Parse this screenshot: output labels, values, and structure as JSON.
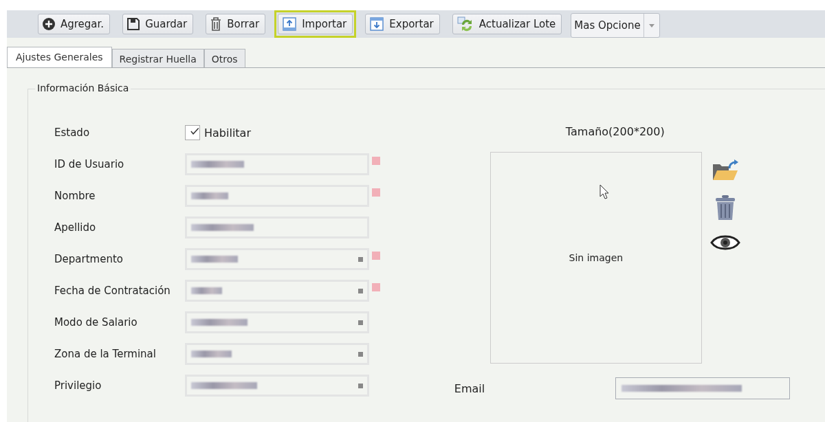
{
  "toolbar": [
    {
      "label": "Agregar.",
      "highlighted": false
    },
    {
      "label": "Guardar",
      "highlighted": false
    },
    {
      "label": "Borrar",
      "highlighted": false
    },
    {
      "label": "Importar",
      "highlighted": true
    },
    {
      "label": "Exportar",
      "highlighted": false
    },
    {
      "label": "Actualizar Lote",
      "highlighted": false
    }
  ],
  "more_options": {
    "value": "Mas Opcione"
  },
  "tabs": [
    {
      "label": "Ajustes Generales",
      "selected": true
    },
    {
      "label": "Registrar Huella",
      "selected": false
    },
    {
      "label": "Otros",
      "selected": false
    }
  ],
  "section": {
    "title": "Información Básica"
  },
  "fields": [
    {
      "label": "Estado",
      "kind": "checkbox",
      "option": "Habilitar",
      "checked": true
    },
    {
      "label": "ID de Usuario",
      "kind": "text",
      "required": true
    },
    {
      "label": "Nombre",
      "kind": "text",
      "required": true
    },
    {
      "label": "Apellido",
      "kind": "text",
      "required": false
    },
    {
      "label": "Departmento",
      "kind": "select",
      "required": true
    },
    {
      "label": "Fecha de Contratación",
      "kind": "select",
      "required": true
    },
    {
      "label": "Modo de Salario",
      "kind": "select",
      "required": false
    },
    {
      "label": "Zona de la Terminal",
      "kind": "select",
      "required": false
    },
    {
      "label": "Privilegio",
      "kind": "select",
      "required": false
    }
  ],
  "photo": {
    "size_label": "Tamaño(200*200)",
    "placeholder": "Sin imagen"
  },
  "email": {
    "label": "Email"
  }
}
